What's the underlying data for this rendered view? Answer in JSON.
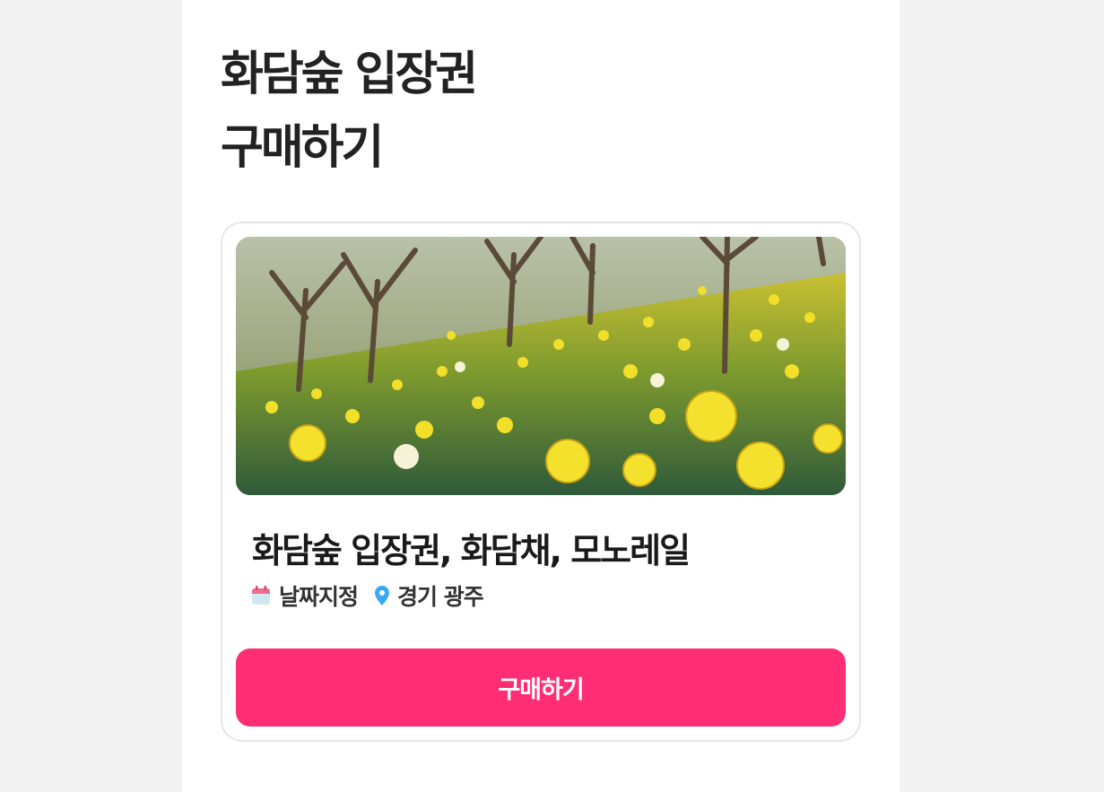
{
  "header": {
    "title_line1": "화담숲 입장권",
    "title_line2": "구매하기"
  },
  "product": {
    "name": "화담숲 입장권, 화담채, 모노레일",
    "date_label": "날짜지정",
    "location_label": "경기 광주",
    "buy_label": "구매하기",
    "image_icon": "daffodil-field-photo"
  },
  "colors": {
    "accent": "#ff2d74",
    "background": "#f2f2f2",
    "location_pin": "#3aa8f5",
    "calendar_top": "#f06b8c",
    "calendar_body": "#cfe8f2"
  }
}
